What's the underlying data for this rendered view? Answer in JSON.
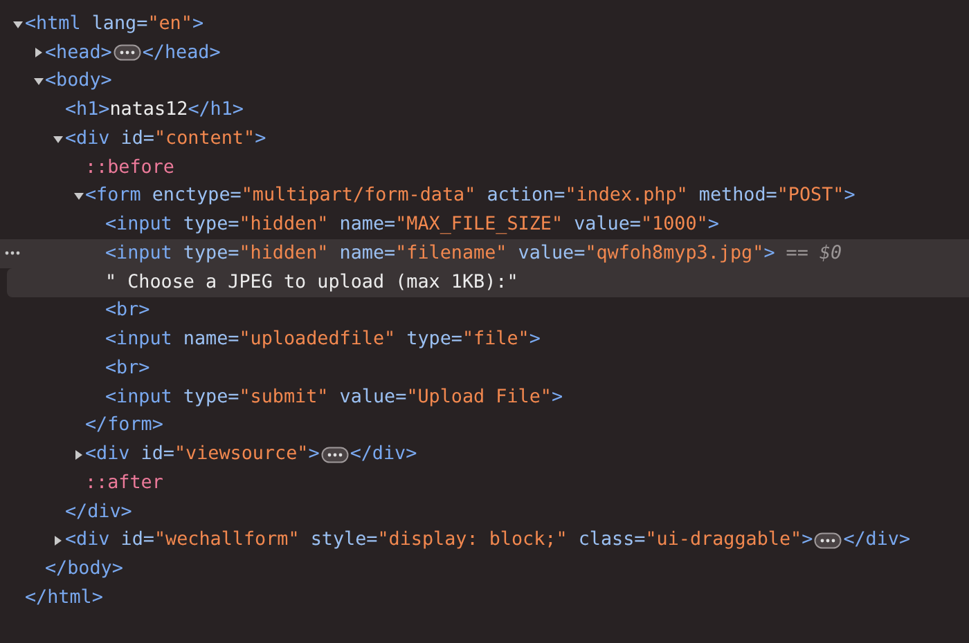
{
  "nodes": [
    {
      "line": [
        {
          "kind": "tag",
          "text": "<html"
        },
        {
          "kind": "attr",
          "text": " lang="
        },
        {
          "kind": "value",
          "text": "\"en\""
        },
        {
          "kind": "tag",
          "text": ">"
        }
      ],
      "expanded": true,
      "selected": false,
      "children": [
        {
          "line": [
            {
              "kind": "tag",
              "text": "<head>"
            },
            {
              "kind": "ellipsis"
            },
            {
              "kind": "tag",
              "text": "</head>"
            }
          ],
          "expanded": false,
          "selected": false
        },
        {
          "line": [
            {
              "kind": "tag",
              "text": "<body>"
            }
          ],
          "expanded": true,
          "selected": false,
          "children": [
            {
              "line": [
                {
                  "kind": "tag",
                  "text": "<h1>"
                },
                {
                  "kind": "text",
                  "text": "natas12"
                },
                {
                  "kind": "tag",
                  "text": "</h1>"
                }
              ],
              "selected": false
            },
            {
              "line": [
                {
                  "kind": "tag",
                  "text": "<div"
                },
                {
                  "kind": "attr",
                  "text": " id="
                },
                {
                  "kind": "value",
                  "text": "\"content\""
                },
                {
                  "kind": "tag",
                  "text": ">"
                }
              ],
              "expanded": true,
              "selected": false,
              "children": [
                {
                  "line": [
                    {
                      "kind": "pseudo",
                      "text": "::before"
                    }
                  ],
                  "selected": false
                },
                {
                  "line": [
                    {
                      "kind": "tag",
                      "text": "<form"
                    },
                    {
                      "kind": "attr",
                      "text": " enctype="
                    },
                    {
                      "kind": "value",
                      "text": "\"multipart/form-data\""
                    },
                    {
                      "kind": "attr",
                      "text": " action="
                    },
                    {
                      "kind": "value",
                      "text": "\"index.php\""
                    },
                    {
                      "kind": "attr",
                      "text": " method="
                    },
                    {
                      "kind": "value",
                      "text": "\"POST\""
                    },
                    {
                      "kind": "tag",
                      "text": ">"
                    }
                  ],
                  "expanded": true,
                  "selected": false,
                  "children": [
                    {
                      "line": [
                        {
                          "kind": "tag",
                          "text": "<input"
                        },
                        {
                          "kind": "attr",
                          "text": " type="
                        },
                        {
                          "kind": "value",
                          "text": "\"hidden\""
                        },
                        {
                          "kind": "attr",
                          "text": " name="
                        },
                        {
                          "kind": "value",
                          "text": "\"MAX_FILE_SIZE\""
                        },
                        {
                          "kind": "attr",
                          "text": " value="
                        },
                        {
                          "kind": "value",
                          "text": "\"1000\""
                        },
                        {
                          "kind": "tag",
                          "text": ">"
                        }
                      ],
                      "selected": false
                    },
                    {
                      "line": [
                        {
                          "kind": "tag",
                          "text": "<input"
                        },
                        {
                          "kind": "attr",
                          "text": " type="
                        },
                        {
                          "kind": "value",
                          "text": "\"hidden\""
                        },
                        {
                          "kind": "attr",
                          "text": " name="
                        },
                        {
                          "kind": "value",
                          "text": "\"filename\""
                        },
                        {
                          "kind": "attr",
                          "text": " value="
                        },
                        {
                          "kind": "value",
                          "text": "\"qwfoh8myp3.jpg\""
                        },
                        {
                          "kind": "tag",
                          "text": ">"
                        },
                        {
                          "kind": "hint",
                          "text": " == $0"
                        }
                      ],
                      "selected": true
                    },
                    {
                      "line": [
                        {
                          "kind": "text",
                          "text": "\" Choose a JPEG to upload (max 1KB):\""
                        }
                      ],
                      "selected": false,
                      "hovered": true
                    },
                    {
                      "line": [
                        {
                          "kind": "tag",
                          "text": "<br>"
                        }
                      ],
                      "selected": false
                    },
                    {
                      "line": [
                        {
                          "kind": "tag",
                          "text": "<input"
                        },
                        {
                          "kind": "attr",
                          "text": " name="
                        },
                        {
                          "kind": "value",
                          "text": "\"uploadedfile\""
                        },
                        {
                          "kind": "attr",
                          "text": " type="
                        },
                        {
                          "kind": "value",
                          "text": "\"file\""
                        },
                        {
                          "kind": "tag",
                          "text": ">"
                        }
                      ],
                      "selected": false
                    },
                    {
                      "line": [
                        {
                          "kind": "tag",
                          "text": "<br>"
                        }
                      ],
                      "selected": false
                    },
                    {
                      "line": [
                        {
                          "kind": "tag",
                          "text": "<input"
                        },
                        {
                          "kind": "attr",
                          "text": " type="
                        },
                        {
                          "kind": "value",
                          "text": "\"submit\""
                        },
                        {
                          "kind": "attr",
                          "text": " value="
                        },
                        {
                          "kind": "value",
                          "text": "\"Upload File\""
                        },
                        {
                          "kind": "tag",
                          "text": ">"
                        }
                      ],
                      "selected": false
                    }
                  ],
                  "end": [
                    {
                      "kind": "tag",
                      "text": "</form>"
                    }
                  ]
                },
                {
                  "line": [
                    {
                      "kind": "tag",
                      "text": "<div"
                    },
                    {
                      "kind": "attr",
                      "text": " id="
                    },
                    {
                      "kind": "value",
                      "text": "\"viewsource\""
                    },
                    {
                      "kind": "tag",
                      "text": ">"
                    },
                    {
                      "kind": "ellipsis"
                    },
                    {
                      "kind": "tag",
                      "text": "</div>"
                    }
                  ],
                  "expanded": false,
                  "selected": false
                },
                {
                  "line": [
                    {
                      "kind": "pseudo",
                      "text": "::after"
                    }
                  ],
                  "selected": false
                }
              ],
              "end": [
                {
                  "kind": "tag",
                  "text": "</div>"
                }
              ]
            },
            {
              "line": [
                {
                  "kind": "tag",
                  "text": "<div"
                },
                {
                  "kind": "attr",
                  "text": " id="
                },
                {
                  "kind": "value",
                  "text": "\"wechallform\""
                },
                {
                  "kind": "attr",
                  "text": " style="
                },
                {
                  "kind": "value",
                  "text": "\"display: block;\""
                },
                {
                  "kind": "attr",
                  "text": " class="
                },
                {
                  "kind": "value",
                  "text": "\"ui-draggable\""
                },
                {
                  "kind": "tag",
                  "text": ">"
                },
                {
                  "kind": "ellipsis"
                },
                {
                  "kind": "tag",
                  "text": "</div>"
                }
              ],
              "expanded": false,
              "selected": false
            }
          ],
          "end": [
            {
              "kind": "tag",
              "text": "</body>"
            }
          ]
        }
      ],
      "end": [
        {
          "kind": "tag",
          "text": "</html>"
        }
      ]
    }
  ]
}
